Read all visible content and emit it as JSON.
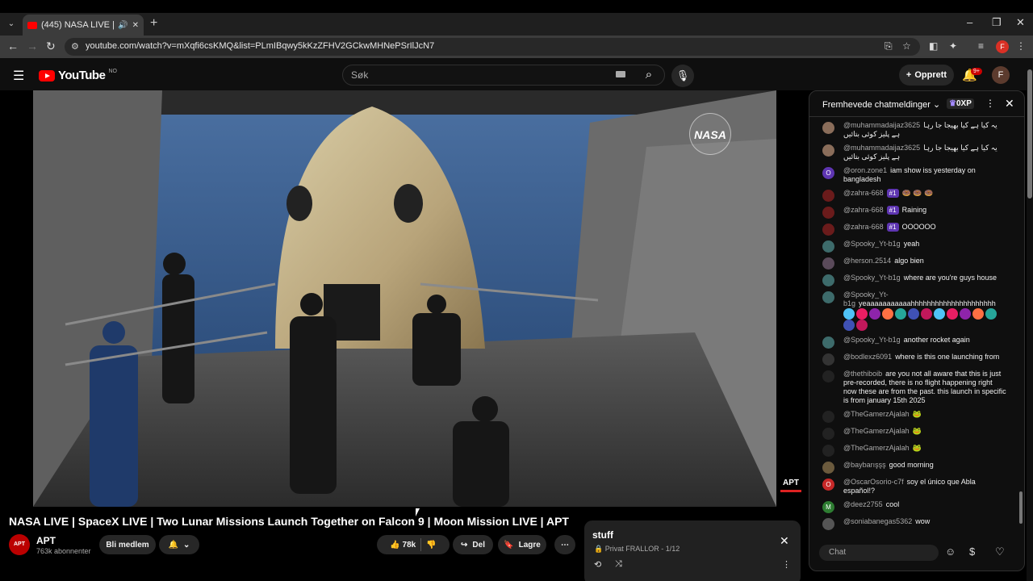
{
  "browser": {
    "tab_title": "(445) NASA LIVE | SpaceX LI",
    "url": "youtube.com/watch?v=mXqfi6csKMQ&list=PLmIBqwy5kKzZFHV2GCkwMHNePSrIlJcN7",
    "profile_initial": "F"
  },
  "header": {
    "logo_text": "YouTube",
    "country_code": "NO",
    "search_placeholder": "Søk",
    "create_label": "Opprett",
    "notification_count": "9+",
    "avatar_initial": "F"
  },
  "video": {
    "watermark": "NASA",
    "channel_bug": "APT",
    "title": "NASA LIVE | SpaceX LIVE | Two Lunar Missions Launch Together on Falcon 9 | Moon Mission LIVE | APT"
  },
  "channel": {
    "name": "APT",
    "subscribers": "763k abonnenter",
    "avatar_text": "APT",
    "join_label": "Bli medlem"
  },
  "actions": {
    "likes": "78k",
    "share_label": "Del",
    "save_label": "Lagre"
  },
  "playlist": {
    "title": "stuff",
    "meta": "Privat FRALLOR - 1/12"
  },
  "chat": {
    "header_title": "Fremhevede chatmeldinger",
    "points": "0XP",
    "input_placeholder": "Chat",
    "messages": [
      {
        "author": "@muhammadaijaz3625",
        "text": "یہ کیا ہے کیا بھیجا جا رہا ہے پلیز کوئی بتائیں",
        "avatar_color": "#8a6d5a"
      },
      {
        "author": "@muhammadaijaz3625",
        "text": "یہ کیا ہے کیا بھیجا جا رہا ہے پلیز کوئی بتائیں",
        "avatar_color": "#8a6d5a"
      },
      {
        "author": "@oron.zone1",
        "text": "iam show iss yesterday on bangladesh",
        "avatar_color": "#5e35b1",
        "avatar_letter": "O"
      },
      {
        "author": "@zahra-668",
        "badge": "#1",
        "text": "🍩 🍩 🍩",
        "avatar_color": "#6a1b1b"
      },
      {
        "author": "@zahra-668",
        "badge": "#1",
        "text": "Raining",
        "avatar_color": "#6a1b1b"
      },
      {
        "author": "@zahra-668",
        "badge": "#1",
        "text": "OOOOOO",
        "avatar_color": "#6a1b1b"
      },
      {
        "author": "@Spooky_Yt-b1g",
        "text": "yeah",
        "avatar_color": "#3d6b6b"
      },
      {
        "author": "@herson.2514",
        "text": "algo bien",
        "avatar_color": "#5a4a5a"
      },
      {
        "author": "@Spooky_Yt-b1g",
        "text": "where are you're guys house",
        "avatar_color": "#3d6b6b"
      },
      {
        "author": "@Spooky_Yt-b1g",
        "text": "yeaaaaaaaaaaahhhhhhhhhhhhhhhhhhhhh",
        "avatar_color": "#3d6b6b",
        "emotes": 14
      },
      {
        "author": "@Spooky_Yt-b1g",
        "text": "another rocket again",
        "avatar_color": "#3d6b6b"
      },
      {
        "author": "@bodlexz6091",
        "text": "where is this one launching from",
        "avatar_color": "#333333"
      },
      {
        "author": "@thethiboib",
        "text": "are you not all aware that this is just pre-recorded, there is no flight happening right now these are from the past. this launch in specific is from january 15th 2025",
        "avatar_color": "#222222"
      },
      {
        "author": "@TheGamerzAjalah",
        "text": "🐸",
        "avatar_color": "#222222"
      },
      {
        "author": "@TheGamerzAjalah",
        "text": "🐸",
        "avatar_color": "#222222"
      },
      {
        "author": "@TheGamerzAjalah",
        "text": "🐸",
        "avatar_color": "#222222"
      },
      {
        "author": "@baybarışşş",
        "text": "good morning",
        "avatar_color": "#6b5a3d"
      },
      {
        "author": "@OscarOsorio-c7f",
        "text": "soy el único que Abla español!?",
        "avatar_color": "#c62828",
        "avatar_letter": "O"
      },
      {
        "author": "@deez2755",
        "text": "cool",
        "avatar_color": "#2e7d32",
        "avatar_letter": "M"
      },
      {
        "author": "@soniabanegas5362",
        "text": "wow",
        "avatar_color": "#555555"
      }
    ]
  }
}
